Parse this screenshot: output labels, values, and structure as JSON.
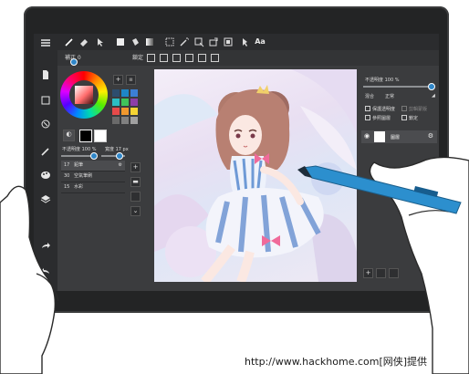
{
  "top_toolbar": {
    "items": [
      {
        "icon": "menu-icon"
      },
      {
        "icon": "brush-icon",
        "selected": true
      },
      {
        "icon": "eraser-icon"
      },
      {
        "icon": "move-icon"
      },
      {
        "icon": "fill-rect-icon"
      },
      {
        "icon": "bucket-icon"
      },
      {
        "icon": "gradient-icon"
      },
      {
        "icon": "select-rect-icon"
      },
      {
        "icon": "magic-wand-icon"
      },
      {
        "icon": "lasso-icon"
      },
      {
        "icon": "transform-icon"
      },
      {
        "icon": "stamp-icon"
      },
      {
        "icon": "pointer-icon"
      }
    ],
    "text_tool_label": "Aa"
  },
  "sub_toolbar": {
    "correction_label": "補正 0",
    "lock_label": "鎖定"
  },
  "left_sidebar": {
    "icons": [
      "file-icon",
      "square-select-icon",
      "rotate-icon",
      "pen-icon",
      "palette-icon",
      "layers-icon",
      "redo-icon",
      "undo-icon"
    ]
  },
  "color_panel": {
    "swatches": [
      "#2d4d6e",
      "#1e86c8",
      "#3c7fd6",
      "#2bbdc3",
      "#3fc45a",
      "#8d3ea8",
      "#e64a4a",
      "#f0982e",
      "#f5d433",
      "#6a6a6a",
      "#808080",
      "#a0a0a0"
    ],
    "opacity_label": "不透明度 100 %",
    "size_label": "寬度 17 px"
  },
  "brush_list": [
    {
      "size": "17",
      "name": "鉛筆",
      "selected": true
    },
    {
      "size": "30",
      "name": "空氣筆刷",
      "selected": false
    },
    {
      "size": "15",
      "name": "水彩",
      "selected": false
    }
  ],
  "layers_panel": {
    "opacity_label": "不透明度 100 %",
    "blend_label": "混合",
    "blend_value": "正常",
    "options": [
      {
        "label": "保護透明度",
        "checked": false
      },
      {
        "label": "剪輯蒙版",
        "checked": false
      },
      {
        "label": "參照圖層",
        "checked": false
      },
      {
        "label": "鎖定",
        "checked": false
      }
    ],
    "layer_name": "圖層"
  },
  "watermark": "http://www.hackhome.com[网侠]提供"
}
